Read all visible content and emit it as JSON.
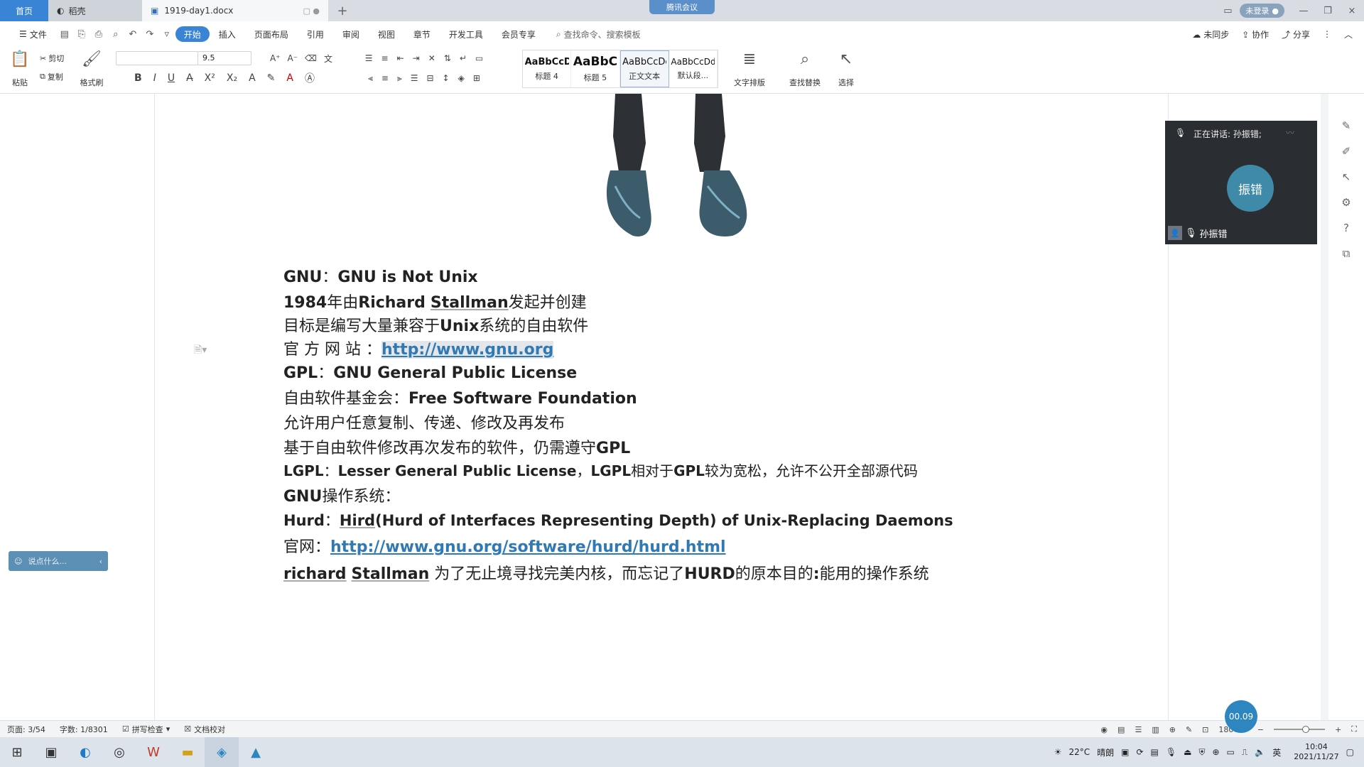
{
  "titlebar": {
    "tabs": [
      "首页",
      "稻壳",
      "1919-day1.docx"
    ],
    "meeting_label": "腾讯会议",
    "login_label": "未登录",
    "close": "×"
  },
  "menubar": {
    "file": "文件",
    "items": [
      "开始",
      "插入",
      "页面布局",
      "引用",
      "审阅",
      "视图",
      "章节",
      "开发工具",
      "会员专享"
    ],
    "search": "查找命令、搜索模板",
    "right": [
      "未同步",
      "协作",
      "分享"
    ]
  },
  "ribbon": {
    "paste": "粘贴",
    "cut": "剪切",
    "copy": "复制",
    "format_painter": "格式刷",
    "font_size": "9.5",
    "styles": [
      {
        "preview": "AaBbCcD",
        "label": "标题 4"
      },
      {
        "preview": "AaBbC",
        "label": "标题 5"
      },
      {
        "preview": "AaBbCcDc",
        "label": "正文文本"
      },
      {
        "preview": "AaBbCcDd",
        "label": "默认段..."
      }
    ],
    "text_layout": "文字排版",
    "find_replace": "查找替换",
    "select": "选择"
  },
  "document": {
    "l1_a": "GNU",
    "l1_b": "：",
    "l1_c": "GNU is Not Unix",
    "l2_a": "1984",
    "l2_b": "年由",
    "l2_c": "Richard",
    "l2_d": " ",
    "l2_e": "Stallman",
    "l2_f": "发起并创建",
    "l3_a": "目标是编写大量兼容于",
    "l3_b": "Unix",
    "l3_c": "系统的自由软件",
    "l4_a": "官 方 网 站 ：",
    "l4_b": "http://www.gnu.org",
    "l5_a": "GPL",
    "l5_b": "：",
    "l5_c": "GNU General Public License",
    "l6_a": "自由软件基金会：",
    "l6_b": "Free Software Foundation",
    "l7": "允许用户任意复制、传递、修改及再发布",
    "l8_a": "基于自由软件修改再次发布的软件，仍需遵守",
    "l8_b": "GPL",
    "l9_a": "LGPL",
    "l9_b": "：",
    "l9_c": "Lesser General Public License",
    "l9_d": "，",
    "l9_e": "LGPL",
    "l9_f": "相对于",
    "l9_g": "GPL",
    "l9_h": "较为宽松，允许不公开全部源代码",
    "l10_a": "GNU",
    "l10_b": "操作系统：",
    "l11_a": "Hurd",
    "l11_b": "：",
    "l11_c": "Hird",
    "l11_d": "(Hurd of Interfaces Representing Depth) of Unix-Replacing Daemons",
    "l12_a": "官网：",
    "l12_b": "http://www.gnu.org/software/hurd/hurd.html",
    "l13_a": "richard",
    "l13_b": " ",
    "l13_c": "Stallman",
    "l13_d": " 为了无止境寻找完美内核，而忘记了",
    "l13_e": "HURD",
    "l13_f": "的原本目的",
    "l13_g": ":",
    "l13_h": "能用的操作系统"
  },
  "speak_bar": {
    "placeholder": "说点什么..."
  },
  "meeting": {
    "speaking": "正在讲话: 孙振错;",
    "avatar": "振错",
    "participant": "孙振错"
  },
  "statusbar": {
    "page": "页面: 3/54",
    "words": "字数: 1/8301",
    "spell": "拼写检查",
    "proof": "文档校对",
    "zoom": "180%",
    "zoom_fraction": 0.62
  },
  "timer": "00.09",
  "taskbar": {
    "weather": "22°C",
    "weather_desc": "晴朗",
    "ime": "英",
    "time": "10:04",
    "date": "2021/11/27"
  }
}
